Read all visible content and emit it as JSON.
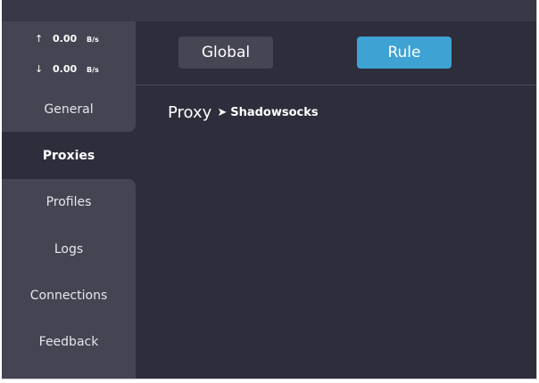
{
  "speed": {
    "upload": {
      "arrow": "↑",
      "value": "0.00",
      "unit": "B/s"
    },
    "download": {
      "arrow": "↓",
      "value": "0.00",
      "unit": "B/s"
    }
  },
  "nav": {
    "general": "General",
    "proxies": "Proxies",
    "profiles": "Profiles",
    "logs": "Logs",
    "connections": "Connections",
    "feedback": "Feedback"
  },
  "mode": {
    "global": "Global",
    "rule": "Rule",
    "active": "Rule"
  },
  "breadcrumb": {
    "root": "Proxy",
    "separator": "➤",
    "leaf": "Shadowsocks"
  },
  "colors": {
    "background": "#2d2d3b",
    "sidebar": "#444452",
    "accent": "#3ea2d3"
  }
}
